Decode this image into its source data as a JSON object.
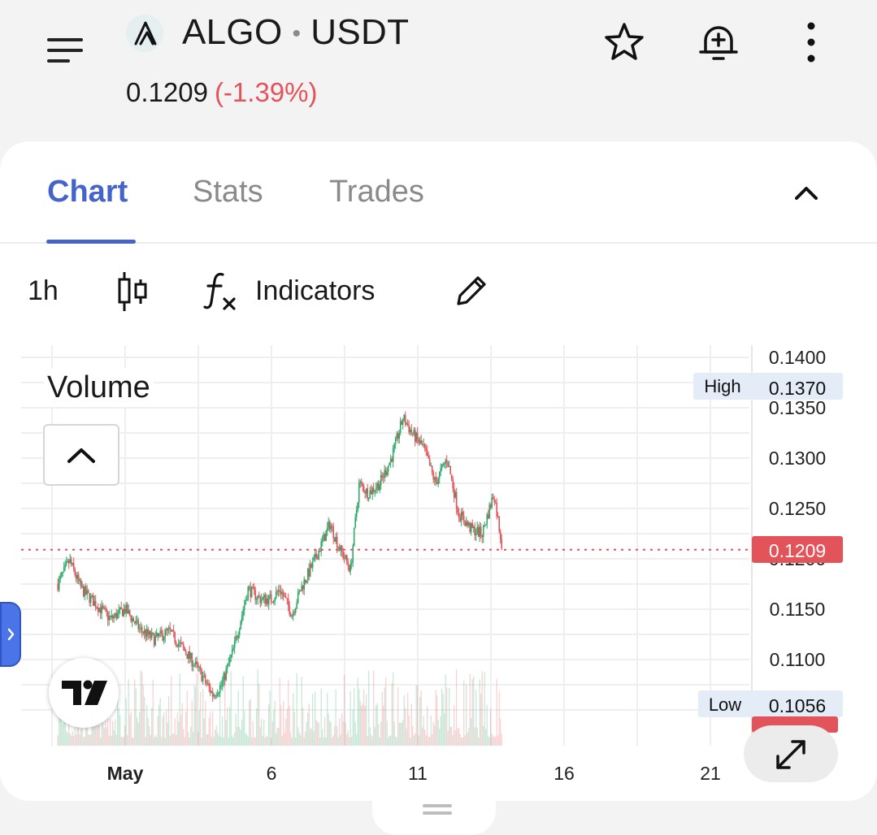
{
  "header": {
    "base": "ALGO",
    "separator": "•",
    "quote": "USDT",
    "price": "0.1209",
    "change": "(-1.39%)",
    "logo_icon": "algorand-icon"
  },
  "tabs": [
    {
      "label": "Chart",
      "active": true
    },
    {
      "label": "Stats",
      "active": false
    },
    {
      "label": "Trades",
      "active": false
    }
  ],
  "toolbar": {
    "interval": "1h",
    "indicators_label": "Indicators"
  },
  "chart": {
    "volume_label": "Volume",
    "high_label": "High",
    "low_label": "Low",
    "current_price_label": "0.1209"
  },
  "colors": {
    "accent": "#4563c9",
    "up": "#2ea96b",
    "down": "#e3545a",
    "side_handle": "#4a74e8"
  },
  "chart_data": {
    "type": "candlestick",
    "interval": "1h",
    "x_tick_labels": [
      "May",
      "6",
      "11",
      "16",
      "21"
    ],
    "y_tick_labels": [
      "0.1400",
      "0.1350",
      "0.1300",
      "0.1250",
      "0.1200",
      "0.1150",
      "0.1100"
    ],
    "ylim": [
      0.104,
      0.141
    ],
    "high": 0.137,
    "low": 0.1056,
    "last": 0.1209,
    "price_path": [
      [
        -2.3,
        0.1175
      ],
      [
        -1.9,
        0.1198
      ],
      [
        -1.5,
        0.117
      ],
      [
        -1.0,
        0.1155
      ],
      [
        -0.5,
        0.114
      ],
      [
        0.0,
        0.115
      ],
      [
        0.5,
        0.113
      ],
      [
        1.0,
        0.112
      ],
      [
        1.5,
        0.1128
      ],
      [
        2.0,
        0.111
      ],
      [
        2.5,
        0.109
      ],
      [
        3.0,
        0.1065
      ],
      [
        3.3,
        0.1075
      ],
      [
        3.7,
        0.111
      ],
      [
        4.2,
        0.117
      ],
      [
        4.6,
        0.116
      ],
      [
        5.0,
        0.116
      ],
      [
        5.3,
        0.117
      ],
      [
        5.7,
        0.1145
      ],
      [
        6.0,
        0.117
      ],
      [
        6.5,
        0.12
      ],
      [
        7.0,
        0.1235
      ],
      [
        7.3,
        0.1212
      ],
      [
        7.7,
        0.119
      ],
      [
        8.0,
        0.1275
      ],
      [
        8.3,
        0.1265
      ],
      [
        8.7,
        0.1275
      ],
      [
        9.1,
        0.13
      ],
      [
        9.5,
        0.134
      ],
      [
        9.8,
        0.1325
      ],
      [
        10.2,
        0.131
      ],
      [
        10.6,
        0.1275
      ],
      [
        11.0,
        0.13
      ],
      [
        11.4,
        0.1245
      ],
      [
        11.8,
        0.123
      ],
      [
        12.2,
        0.1225
      ],
      [
        12.6,
        0.1265
      ],
      [
        12.9,
        0.1209
      ]
    ],
    "volume_present": true
  }
}
